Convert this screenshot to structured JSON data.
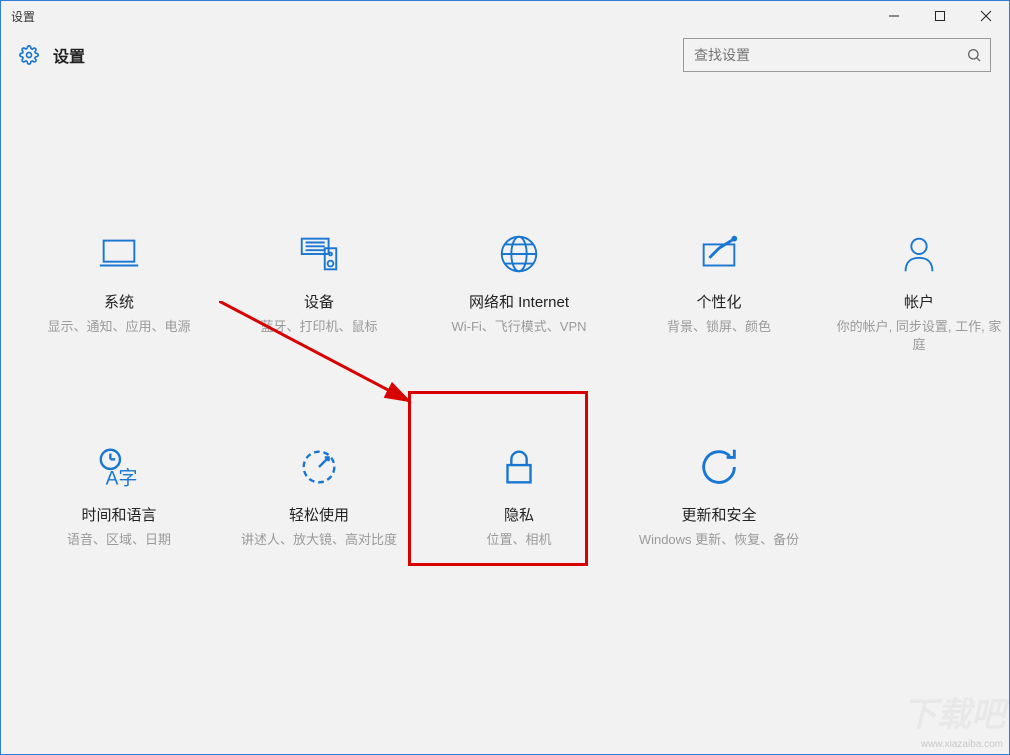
{
  "titlebar": {
    "text": "设置"
  },
  "header": {
    "title": "设置"
  },
  "search": {
    "placeholder": "查找设置"
  },
  "tiles": [
    {
      "title": "系统",
      "desc": "显示、通知、应用、电源"
    },
    {
      "title": "设备",
      "desc": "蓝牙、打印机、鼠标"
    },
    {
      "title": "网络和 Internet",
      "desc": "Wi-Fi、飞行模式、VPN"
    },
    {
      "title": "个性化",
      "desc": "背景、锁屏、颜色"
    },
    {
      "title": "帐户",
      "desc": "你的帐户, 同步设置, 工作, 家庭"
    },
    {
      "title": "时间和语言",
      "desc": "语音、区域、日期"
    },
    {
      "title": "轻松使用",
      "desc": "讲述人、放大镜、高对比度"
    },
    {
      "title": "隐私",
      "desc": "位置、相机"
    },
    {
      "title": "更新和安全",
      "desc": "Windows 更新、恢复、备份"
    }
  ],
  "watermark": {
    "small": "www.xiazaiba.com",
    "big": "下载吧"
  }
}
